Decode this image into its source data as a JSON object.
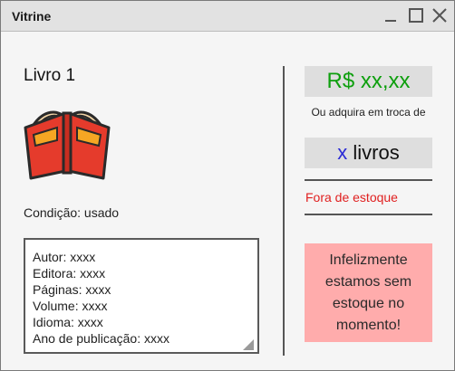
{
  "window": {
    "title": "Vitrine",
    "controls": [
      "minimize-icon",
      "maximize-icon",
      "close-icon"
    ]
  },
  "book": {
    "title": "Livro 1",
    "icon": "book-open-icon",
    "condition": "Condição: usado",
    "details": [
      "Autor: xxxx",
      "Editora: xxxx",
      "Páginas: xxxx",
      "Volume: xxxx",
      "Idioma: xxxx",
      "Ano de publicação: xxxx"
    ]
  },
  "purchase": {
    "price": "R$ xx,xx",
    "trade_text": "Ou adquira em troca de",
    "books_count": "x",
    "books_label": "livros",
    "stock_status": "Fora de estoque",
    "out_of_stock_message": "Infelizmente estamos sem estoque no momento!"
  },
  "colors": {
    "price": "#0e9f0e",
    "count": "#2b2bd6",
    "stock_status": "#e02020",
    "alert_bg": "#ffacac"
  }
}
